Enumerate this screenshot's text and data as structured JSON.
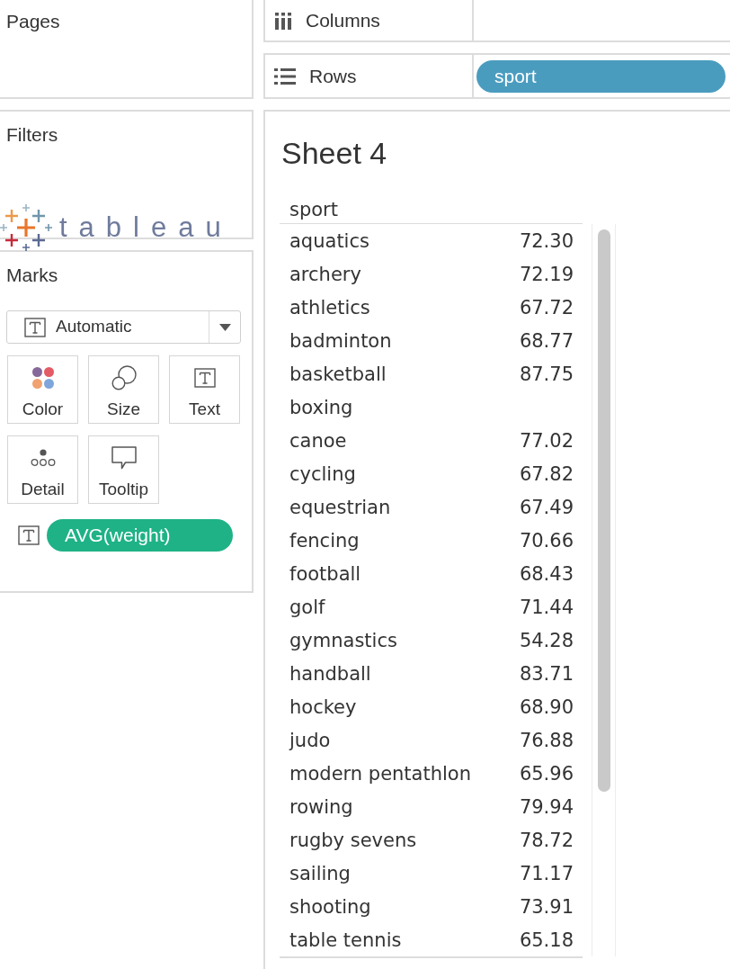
{
  "pages_card": {
    "title": "Pages"
  },
  "filters_card": {
    "title": "Filters"
  },
  "logo": {
    "wordmark": "tableau"
  },
  "marks_card": {
    "title": "Marks",
    "mark_type": "Automatic",
    "buttons": [
      {
        "kind": "color",
        "label": "Color"
      },
      {
        "kind": "size",
        "label": "Size"
      },
      {
        "kind": "text",
        "label": "Text"
      },
      {
        "kind": "detail",
        "label": "Detail"
      },
      {
        "kind": "tooltip",
        "label": "Tooltip"
      }
    ],
    "fields": [
      {
        "kind": "text",
        "pill": {
          "kind": "measure",
          "label": "AVG(weight)"
        }
      }
    ]
  },
  "shelves": [
    {
      "kind": "columns",
      "label": "Columns"
    },
    {
      "kind": "rows",
      "label": "Rows",
      "pills": [
        {
          "label": "sport",
          "kind": "dimension"
        }
      ]
    }
  ],
  "sheet": {
    "title": "Sheet 4",
    "table": {
      "columns": [
        "sport"
      ],
      "rows": [
        {
          "label": "aquatics",
          "value": "72.30"
        },
        {
          "label": "archery",
          "value": "72.19"
        },
        {
          "label": "athletics",
          "value": "67.72"
        },
        {
          "label": "badminton",
          "value": "68.77"
        },
        {
          "label": "basketball",
          "value": "87.75"
        },
        {
          "label": "boxing"
        },
        {
          "label": "canoe",
          "value": "77.02"
        },
        {
          "label": "cycling",
          "value": "67.82"
        },
        {
          "label": "equestrian",
          "value": "67.49"
        },
        {
          "label": "fencing",
          "value": "70.66"
        },
        {
          "label": "football",
          "value": "68.43"
        },
        {
          "label": "golf",
          "value": "71.44"
        },
        {
          "label": "gymnastics",
          "value": "54.28"
        },
        {
          "label": "handball",
          "value": "83.71"
        },
        {
          "label": "hockey",
          "value": "68.90"
        },
        {
          "label": "judo",
          "value": "76.88"
        },
        {
          "label": "modern pentathlon",
          "value": "65.96"
        },
        {
          "label": "rowing",
          "value": "79.94"
        },
        {
          "label": "rugby sevens",
          "value": "78.72"
        },
        {
          "label": "sailing",
          "value": "71.17"
        },
        {
          "label": "shooting",
          "value": "73.91"
        },
        {
          "label": "table tennis",
          "value": "65.18"
        }
      ]
    }
  }
}
